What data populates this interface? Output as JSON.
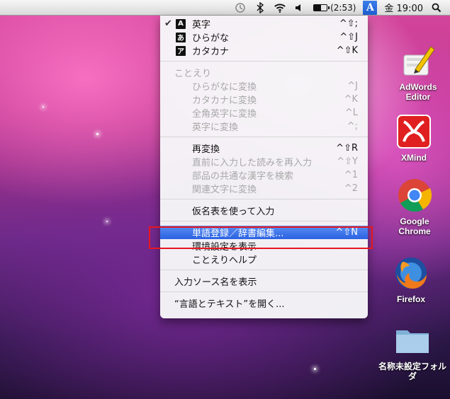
{
  "menubar": {
    "battery_text": "(2:53)",
    "battery_level": 0.55,
    "ime_label": "A",
    "clock": "金 19:00"
  },
  "menu": {
    "modes": [
      {
        "label": "英字",
        "badge": "A",
        "shortcut": "^⇧;",
        "checked": true
      },
      {
        "label": "ひらがな",
        "badge": "あ",
        "shortcut": "^⇧J",
        "checked": false
      },
      {
        "label": "カタカナ",
        "badge": "ア",
        "shortcut": "^⇧K",
        "checked": false
      }
    ],
    "kotoeri_header": "ことえり",
    "convert_items": [
      {
        "label": "ひらがなに変換",
        "shortcut": "^J"
      },
      {
        "label": "カタカナに変換",
        "shortcut": "^K"
      },
      {
        "label": "全角英字に変換",
        "shortcut": "^L"
      },
      {
        "label": "英字に変換",
        "shortcut": "^;"
      }
    ],
    "reconvert": {
      "label": "再変換",
      "shortcut": "^⇧R"
    },
    "reinput": {
      "label": "直前に入力した読みを再入力",
      "shortcut": "^⇧Y"
    },
    "search_kanji": {
      "label": "部品の共通な漢字を検索",
      "shortcut": "^1"
    },
    "related_chars": {
      "label": "関連文字に変換",
      "shortcut": "^2"
    },
    "kana_table": "仮名表を使って入力",
    "word_register": {
      "label": "単語登録／辞書編集...",
      "shortcut": "^⇧N"
    },
    "preferences": "環境設定を表示",
    "help": "ことえりヘルプ",
    "show_source_name": "入力ソース名を表示",
    "open_lang_text": "“言語とテキスト”を開く..."
  },
  "desktop": {
    "icons": [
      {
        "label": "AdWords\nEditor"
      },
      {
        "label": "XMind"
      },
      {
        "label": "Google\nChrome"
      },
      {
        "label": "Firefox"
      },
      {
        "label": "名称未設定フォル\nダ"
      }
    ]
  },
  "colors": {
    "highlight": "#2a62e2",
    "red_box": "#e8161e"
  }
}
